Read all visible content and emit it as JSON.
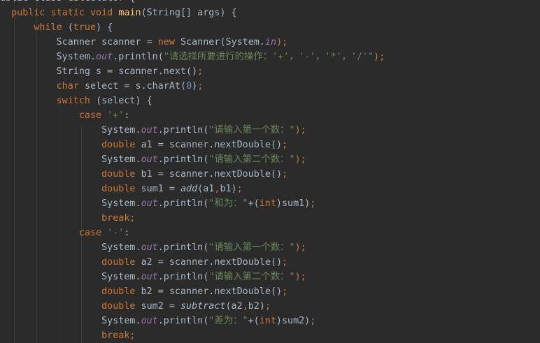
{
  "editor": {
    "language": "java",
    "colors": {
      "background": "#2b2b2b",
      "text": "#a9b7c6",
      "keyword": "#cc7832",
      "string": "#6a8759",
      "field": "#9876aa",
      "number": "#6897bb",
      "method_declaration": "#ffc66d",
      "indent_guide": "#393939"
    },
    "lines": [
      {
        "indent": "",
        "tokens": [
          {
            "t": "ublic class Calculator {",
            "c": ""
          }
        ]
      },
      {
        "indent": "  ",
        "tokens": [
          {
            "t": "public static void ",
            "c": "kw"
          },
          {
            "t": "main",
            "c": "fn"
          },
          {
            "t": "(String[] args) {",
            "c": ""
          }
        ]
      },
      {
        "indent": "      ",
        "tokens": [
          {
            "t": "while ",
            "c": "kw"
          },
          {
            "t": "(",
            "c": ""
          },
          {
            "t": "true",
            "c": "kw"
          },
          {
            "t": ") {",
            "c": ""
          }
        ]
      },
      {
        "indent": "          ",
        "tokens": [
          {
            "t": "Scanner scanner = ",
            "c": ""
          },
          {
            "t": "new ",
            "c": "kw"
          },
          {
            "t": "Scanner(System.",
            "c": ""
          },
          {
            "t": "in",
            "c": "fld"
          },
          {
            "t": ");",
            "c": "kw"
          }
        ]
      },
      {
        "indent": "          ",
        "tokens": [
          {
            "t": "System.",
            "c": ""
          },
          {
            "t": "out",
            "c": "fld"
          },
          {
            "t": ".println(",
            "c": ""
          },
          {
            "t": "\"请选择所要进行的操作：'+'，'-'，'*'，'/'\"",
            "c": "str"
          },
          {
            "t": ");",
            "c": "kw"
          }
        ]
      },
      {
        "indent": "          ",
        "tokens": [
          {
            "t": "String s = scanner.next()",
            "c": ""
          },
          {
            "t": ";",
            "c": "kw"
          }
        ]
      },
      {
        "indent": "          ",
        "tokens": [
          {
            "t": "char ",
            "c": "kw"
          },
          {
            "t": "select = s.charAt(",
            "c": ""
          },
          {
            "t": "0",
            "c": "num"
          },
          {
            "t": ")",
            "c": ""
          },
          {
            "t": ";",
            "c": "kw"
          }
        ]
      },
      {
        "indent": "          ",
        "tokens": [
          {
            "t": "switch ",
            "c": "kw"
          },
          {
            "t": "(select) {",
            "c": ""
          }
        ]
      },
      {
        "indent": "              ",
        "tokens": [
          {
            "t": "case ",
            "c": "kw"
          },
          {
            "t": "'+'",
            "c": "str"
          },
          {
            "t": ":",
            "c": ""
          }
        ]
      },
      {
        "indent": "                  ",
        "tokens": [
          {
            "t": "System.",
            "c": ""
          },
          {
            "t": "out",
            "c": "fld"
          },
          {
            "t": ".println(",
            "c": ""
          },
          {
            "t": "\"请输入第一个数：\"",
            "c": "str"
          },
          {
            "t": ");",
            "c": "kw"
          }
        ]
      },
      {
        "indent": "                  ",
        "tokens": [
          {
            "t": "double ",
            "c": "kw"
          },
          {
            "t": "a1 = scanner.nextDouble()",
            "c": ""
          },
          {
            "t": ";",
            "c": "kw"
          }
        ]
      },
      {
        "indent": "                  ",
        "tokens": [
          {
            "t": "System.",
            "c": ""
          },
          {
            "t": "out",
            "c": "fld"
          },
          {
            "t": ".println(",
            "c": ""
          },
          {
            "t": "\"请输入第二个数：\"",
            "c": "str"
          },
          {
            "t": ");",
            "c": "kw"
          }
        ]
      },
      {
        "indent": "                  ",
        "tokens": [
          {
            "t": "double ",
            "c": "kw"
          },
          {
            "t": "b1 = scanner.nextDouble()",
            "c": ""
          },
          {
            "t": ";",
            "c": "kw"
          }
        ]
      },
      {
        "indent": "                  ",
        "tokens": [
          {
            "t": "double ",
            "c": "kw"
          },
          {
            "t": "sum1 = ",
            "c": ""
          },
          {
            "t": "add",
            "c": "it"
          },
          {
            "t": "(a1",
            "c": ""
          },
          {
            "t": ",",
            "c": "kw"
          },
          {
            "t": "b1)",
            "c": ""
          },
          {
            "t": ";",
            "c": "kw"
          }
        ]
      },
      {
        "indent": "                  ",
        "tokens": [
          {
            "t": "System.",
            "c": ""
          },
          {
            "t": "out",
            "c": "fld"
          },
          {
            "t": ".println(",
            "c": ""
          },
          {
            "t": "\"和为：\"",
            "c": "str"
          },
          {
            "t": "+(",
            "c": ""
          },
          {
            "t": "int",
            "c": "kw"
          },
          {
            "t": ")sum1)",
            "c": ""
          },
          {
            "t": ";",
            "c": "kw"
          }
        ]
      },
      {
        "indent": "                  ",
        "tokens": [
          {
            "t": "break;",
            "c": "kw"
          }
        ]
      },
      {
        "indent": "              ",
        "tokens": [
          {
            "t": "case ",
            "c": "kw"
          },
          {
            "t": "'-'",
            "c": "str"
          },
          {
            "t": ":",
            "c": ""
          }
        ]
      },
      {
        "indent": "                  ",
        "tokens": [
          {
            "t": "System.",
            "c": ""
          },
          {
            "t": "out",
            "c": "fld"
          },
          {
            "t": ".println(",
            "c": ""
          },
          {
            "t": "\"请输入第一个数：\"",
            "c": "str"
          },
          {
            "t": ");",
            "c": "kw"
          }
        ]
      },
      {
        "indent": "                  ",
        "tokens": [
          {
            "t": "double ",
            "c": "kw"
          },
          {
            "t": "a2 = scanner.nextDouble()",
            "c": ""
          },
          {
            "t": ";",
            "c": "kw"
          }
        ]
      },
      {
        "indent": "                  ",
        "tokens": [
          {
            "t": "System.",
            "c": ""
          },
          {
            "t": "out",
            "c": "fld"
          },
          {
            "t": ".println(",
            "c": ""
          },
          {
            "t": "\"请输入第二个数：\"",
            "c": "str"
          },
          {
            "t": ");",
            "c": "kw"
          }
        ]
      },
      {
        "indent": "                  ",
        "tokens": [
          {
            "t": "double ",
            "c": "kw"
          },
          {
            "t": "b2 = scanner.nextDouble()",
            "c": ""
          },
          {
            "t": ";",
            "c": "kw"
          }
        ]
      },
      {
        "indent": "                  ",
        "tokens": [
          {
            "t": "double ",
            "c": "kw"
          },
          {
            "t": "sum2 = ",
            "c": ""
          },
          {
            "t": "subtract",
            "c": "it"
          },
          {
            "t": "(a2",
            "c": ""
          },
          {
            "t": ",",
            "c": "kw"
          },
          {
            "t": "b2)",
            "c": ""
          },
          {
            "t": ";",
            "c": "kw"
          }
        ]
      },
      {
        "indent": "                  ",
        "tokens": [
          {
            "t": "System.",
            "c": ""
          },
          {
            "t": "out",
            "c": "fld"
          },
          {
            "t": ".println(",
            "c": ""
          },
          {
            "t": "\"差为：\"",
            "c": "str"
          },
          {
            "t": "+(",
            "c": ""
          },
          {
            "t": "int",
            "c": "kw"
          },
          {
            "t": ")sum2)",
            "c": ""
          },
          {
            "t": ";",
            "c": "kw"
          }
        ]
      },
      {
        "indent": "                  ",
        "tokens": [
          {
            "t": "break;",
            "c": "kw"
          }
        ]
      }
    ]
  }
}
